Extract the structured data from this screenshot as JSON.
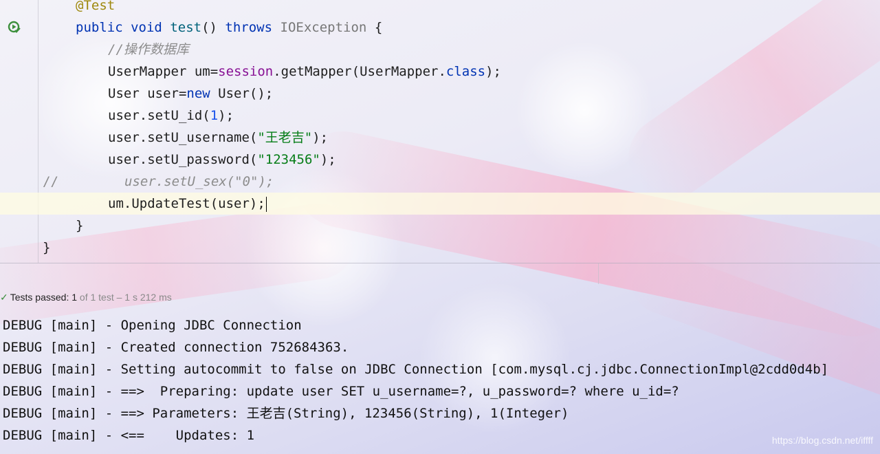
{
  "editor": {
    "lines": {
      "l0": {
        "annotation": "@Test"
      },
      "l1": {
        "kw_public": "public",
        "kw_void": "void",
        "method": "test",
        "parens": "()",
        "kw_throws": "throws",
        "exception": "IOException",
        "brace": "{"
      },
      "l2": {
        "comment": "//操作数据库"
      },
      "l3": {
        "a": "UserMapper um=",
        "b": "session",
        "c": ".getMapper(UserMapper.",
        "d": "class",
        "e": ");"
      },
      "l4": {
        "a": "User user=",
        "b": "new",
        "c": " User();"
      },
      "l5": {
        "a": "user.setU_id(",
        "b": "1",
        "c": ");"
      },
      "l6": {
        "a": "user.setU_username(",
        "b": "\"王老吉\"",
        "c": ");"
      },
      "l7": {
        "a": "user.setU_password(",
        "b": "\"123456\"",
        "c": ");"
      },
      "l8": {
        "slashes": "//",
        "code": "user.setU_sex(\"0\");"
      },
      "l9": {
        "code": "um.UpdateTest(user);"
      },
      "l10": {
        "code": "}"
      },
      "l11": {
        "code": "}"
      }
    }
  },
  "test_status": {
    "label": "Tests passed:",
    "count": "1",
    "detail": "of 1 test – 1 s 212 ms"
  },
  "console": [
    "DEBUG [main] - Opening JDBC Connection",
    "DEBUG [main] - Created connection 752684363.",
    "DEBUG [main] - Setting autocommit to false on JDBC Connection [com.mysql.cj.jdbc.ConnectionImpl@2cdd0d4b]",
    "DEBUG [main] - ==>  Preparing: update user SET u_username=?, u_password=? where u_id=?",
    "DEBUG [main] - ==> Parameters: 王老吉(String), 123456(String), 1(Integer)",
    "DEBUG [main] - <==    Updates: 1"
  ],
  "watermark": "https://blog.csdn.net/iffff",
  "icons": {
    "run": "run-test-gutter-icon",
    "passed": "check-icon"
  }
}
